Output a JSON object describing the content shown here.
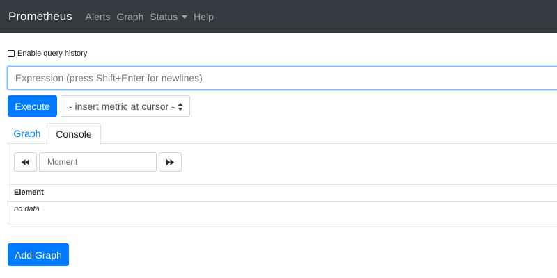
{
  "navbar": {
    "brand": "Prometheus",
    "items": [
      {
        "label": "Alerts"
      },
      {
        "label": "Graph"
      },
      {
        "label": "Status"
      },
      {
        "label": "Help"
      }
    ]
  },
  "query_history": {
    "label": "Enable query history",
    "checked": false
  },
  "expression": {
    "placeholder": "Expression (press Shift+Enter for newlines)",
    "value": ""
  },
  "execute_label": "Execute",
  "metric_select": {
    "selected": "- insert metric at cursor -"
  },
  "tabs": [
    {
      "label": "Graph",
      "active": false
    },
    {
      "label": "Console",
      "active": true
    }
  ],
  "console": {
    "moment_placeholder": "Moment",
    "table": {
      "headers": [
        "Element"
      ],
      "empty_text": "no data"
    }
  },
  "add_graph_label": "Add Graph",
  "colors": {
    "navbar": "#343a40",
    "primary": "#007bff",
    "link": "#007bff",
    "border": "#dee2e6"
  }
}
